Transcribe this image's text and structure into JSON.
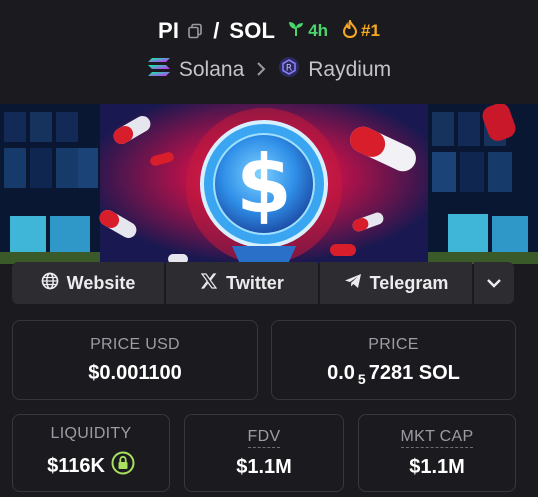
{
  "header": {
    "base_symbol": "PI",
    "separator": "/",
    "quote_symbol": "SOL",
    "age": "4h",
    "rank": "#1",
    "chain": "Solana",
    "dex": "Raydium"
  },
  "links": {
    "website": "Website",
    "twitter": "Twitter",
    "telegram": "Telegram"
  },
  "stats": {
    "price_usd_label": "PRICE USD",
    "price_usd": "$0.001100",
    "price_label": "PRICE",
    "price_prefix": "0.0",
    "price_zeros": "5",
    "price_digits": "7281 SOL",
    "liquidity_label": "LIQUIDITY",
    "liquidity": "$116K",
    "fdv_label": "FDV",
    "fdv": "$1.1M",
    "mktcap_label": "MKT CAP",
    "mktcap": "$1.1M"
  },
  "colors": {
    "background": "#1b1b1f",
    "age_green": "#4ad66d",
    "rank_orange": "#f7a823",
    "lock_green": "#a8e05f"
  },
  "icons": [
    "copy-icon",
    "seedling-icon",
    "flame-icon",
    "solana-icon",
    "chevron-right-icon",
    "raydium-icon",
    "globe-icon",
    "x-logo-icon",
    "telegram-icon",
    "chevron-down-icon",
    "lock-icon"
  ]
}
